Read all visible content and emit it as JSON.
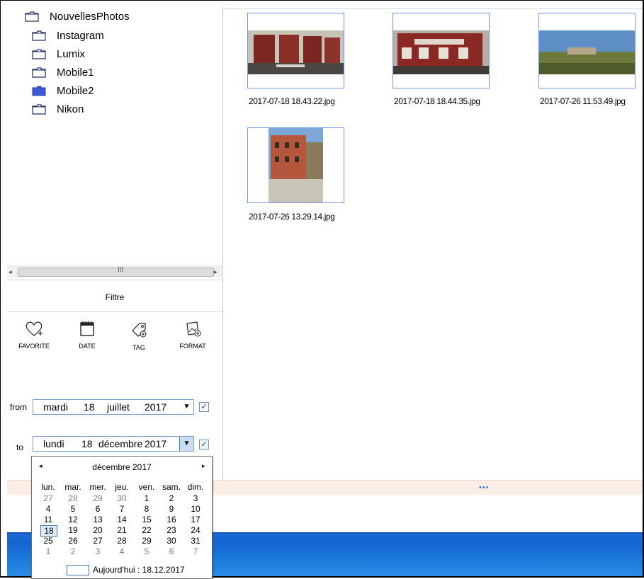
{
  "folders": [
    {
      "label": "NouvellesPhotos",
      "selected": false
    },
    {
      "label": "Instagram",
      "selected": false
    },
    {
      "label": "Lumix",
      "selected": false
    },
    {
      "label": "Mobile1",
      "selected": false
    },
    {
      "label": "Mobile2",
      "selected": true
    },
    {
      "label": "Nikon",
      "selected": false
    }
  ],
  "scrollbar": {
    "grip": "III"
  },
  "filter": {
    "title": "Filtre",
    "buttons": [
      {
        "label": "FAVORITE",
        "icon": "heart-icon"
      },
      {
        "label": "DATE",
        "icon": "calendar-icon"
      },
      {
        "label": "TAG",
        "icon": "tag-icon"
      },
      {
        "label": "FORMAT",
        "icon": "image-format-icon"
      }
    ],
    "from": {
      "label": "from",
      "weekday": "mardi",
      "day": "18",
      "month": "juillet",
      "year": "2017",
      "checked": "✓"
    },
    "to": {
      "label": "to",
      "weekday": "lundi",
      "day": "18",
      "month": "décembre",
      "year": "2017",
      "checked": "✓"
    }
  },
  "photos": [
    {
      "name": "2017-07-18 18.43.22.jpg"
    },
    {
      "name": "2017-07-18 18.44.35.jpg"
    },
    {
      "name": "2017-07-26 11.53.49.jpg"
    },
    {
      "name": "2017-07-26 13.29.14.jpg"
    }
  ],
  "calendar": {
    "month_title": "décembre 2017",
    "prev": "◂",
    "next": "▸",
    "weekdays": [
      "lun.",
      "mar.",
      "mer.",
      "jeu.",
      "ven.",
      "sam.",
      "dim."
    ],
    "weeks": [
      [
        "27",
        "28",
        "29",
        "30",
        "1",
        "2",
        "3"
      ],
      [
        "4",
        "5",
        "6",
        "7",
        "8",
        "9",
        "10"
      ],
      [
        "11",
        "12",
        "13",
        "14",
        "15",
        "16",
        "17"
      ],
      [
        "18",
        "19",
        "20",
        "21",
        "22",
        "23",
        "24"
      ],
      [
        "25",
        "26",
        "27",
        "28",
        "29",
        "30",
        "31"
      ],
      [
        "1",
        "2",
        "3",
        "4",
        "5",
        "6",
        "7"
      ]
    ],
    "selected_day": "18",
    "today_label": "Aujourd'hui : 18.12.2017"
  },
  "grip": "•••",
  "colors": {
    "accent": "#3e5ad6",
    "thumb_border": "#6d9cea",
    "taskbar": "#1b79da"
  }
}
